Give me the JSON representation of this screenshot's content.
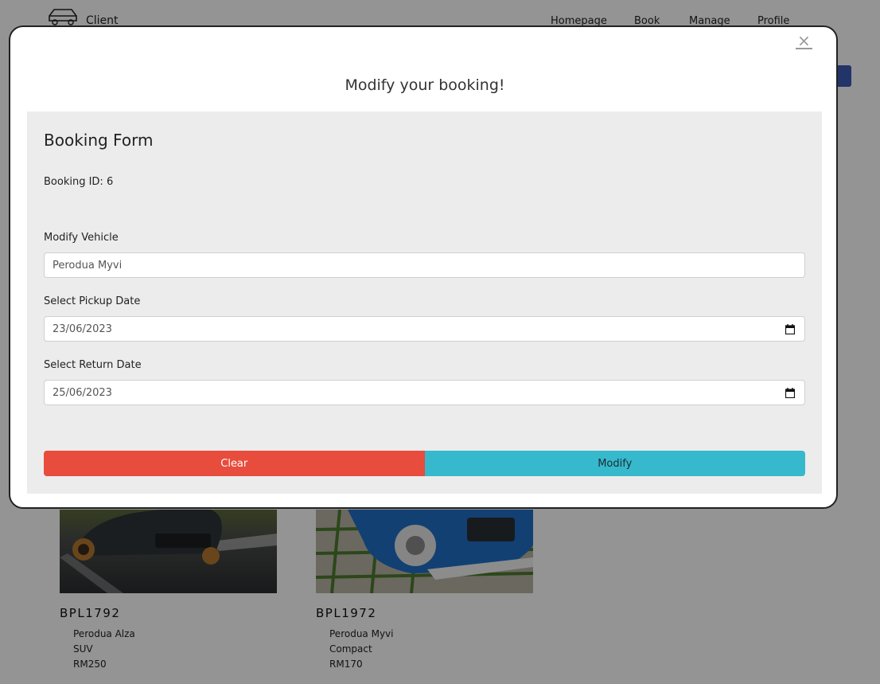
{
  "nav": {
    "brand": "Client",
    "links": [
      "Homepage",
      "Book",
      "Manage",
      "Profile"
    ]
  },
  "cars": [
    {
      "plate": "BPL1792",
      "model": "Perodua Alza",
      "type": "SUV",
      "price": "RM250",
      "color": "#3a4247"
    },
    {
      "plate": "BPL1972",
      "model": "Perodua Myvi",
      "type": "Compact",
      "price": "RM170",
      "color": "#1f6fc7"
    }
  ],
  "modal": {
    "close_symbol": "×",
    "title": "Modify your booking!",
    "form": {
      "heading": "Booking Form",
      "booking_id": "Booking ID: 6",
      "vehicle_label": "Modify Vehicle",
      "vehicle_value": "Perodua Myvi",
      "pickup_label": "Select Pickup Date",
      "pickup_value": "23/06/2023",
      "return_label": "Select Return Date",
      "return_value": "25/06/2023",
      "clear_label": "Clear",
      "modify_label": "Modify"
    }
  },
  "colors": {
    "clear": "#e74c3c",
    "modify": "#36b9cc",
    "accent_blue": "#3b5bb3"
  }
}
